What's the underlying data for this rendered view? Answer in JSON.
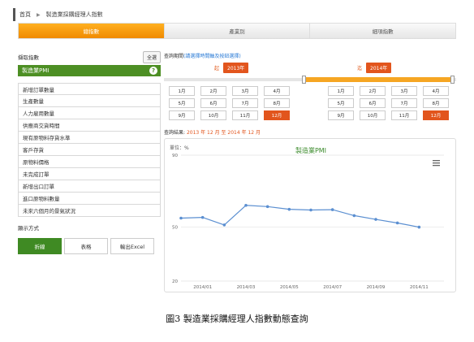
{
  "breadcrumb": {
    "home": "首頁",
    "current": "製造業採購經理人指數"
  },
  "tabs": [
    {
      "label": "總指數",
      "active": true
    },
    {
      "label": "產業別",
      "active": false
    },
    {
      "label": "細項指數",
      "active": false
    }
  ],
  "indicator_panel": {
    "heading": "擷取指數",
    "all_button": "全選",
    "selected": "製造業PMI",
    "help_icon": "?",
    "items": [
      "新增訂單數量",
      "生產數量",
      "人力雇用數量",
      "供應商交貨時間",
      "現有原物料存貨水準",
      "客戶存貨",
      "原物料價格",
      "未完成訂單",
      "新增出口訂單",
      "進口原物料數量",
      "未來六個月的景氣狀況"
    ]
  },
  "display": {
    "label": "顯示方式",
    "buttons": [
      {
        "label": "折線",
        "active": true
      },
      {
        "label": "表格",
        "active": false
      },
      {
        "label": "輸出Excel",
        "active": false
      }
    ]
  },
  "period": {
    "label": "查詢期間",
    "hint": "(請選擇時間軸及按鈕選擇)",
    "from_label": "起",
    "from_year": "2013年",
    "to_label": "迄",
    "to_year": "2014年",
    "months": [
      "1月",
      "2月",
      "3月",
      "4月",
      "5月",
      "6月",
      "7月",
      "8月",
      "9月",
      "10月",
      "11月",
      "12月"
    ],
    "from_selected_month": "12月",
    "to_selected_month": "12月"
  },
  "result": {
    "label": "查詢結果:",
    "value": "2013 年 12 月 至 2014 年 12 月"
  },
  "chart_data": {
    "type": "line",
    "title": "製造業PMI",
    "unit_label": "單位：%",
    "menu_icon": "hamburger-icon",
    "ylim": [
      20,
      90
    ],
    "y_ticks": [
      90,
      50,
      20
    ],
    "x": [
      "2013/12",
      "2014/01",
      "2014/02",
      "2014/03",
      "2014/04",
      "2014/05",
      "2014/06",
      "2014/07",
      "2014/08",
      "2014/09",
      "2014/10",
      "2014/11",
      "2014/12"
    ],
    "x_tick_labels": [
      "2014/01",
      "2014/03",
      "2014/05",
      "2014/07",
      "2014/09",
      "2014/11"
    ],
    "series": [
      {
        "values": [
          55.0,
          55.4,
          51.2,
          62.1,
          61.4,
          59.9,
          59.5,
          59.7,
          56.4,
          54.3,
          52.3,
          50.0
        ]
      }
    ],
    "line_color": "#5b8fd1",
    "grid": true
  },
  "caption": "圖3 製造業採購經理人指數動態查詢"
}
